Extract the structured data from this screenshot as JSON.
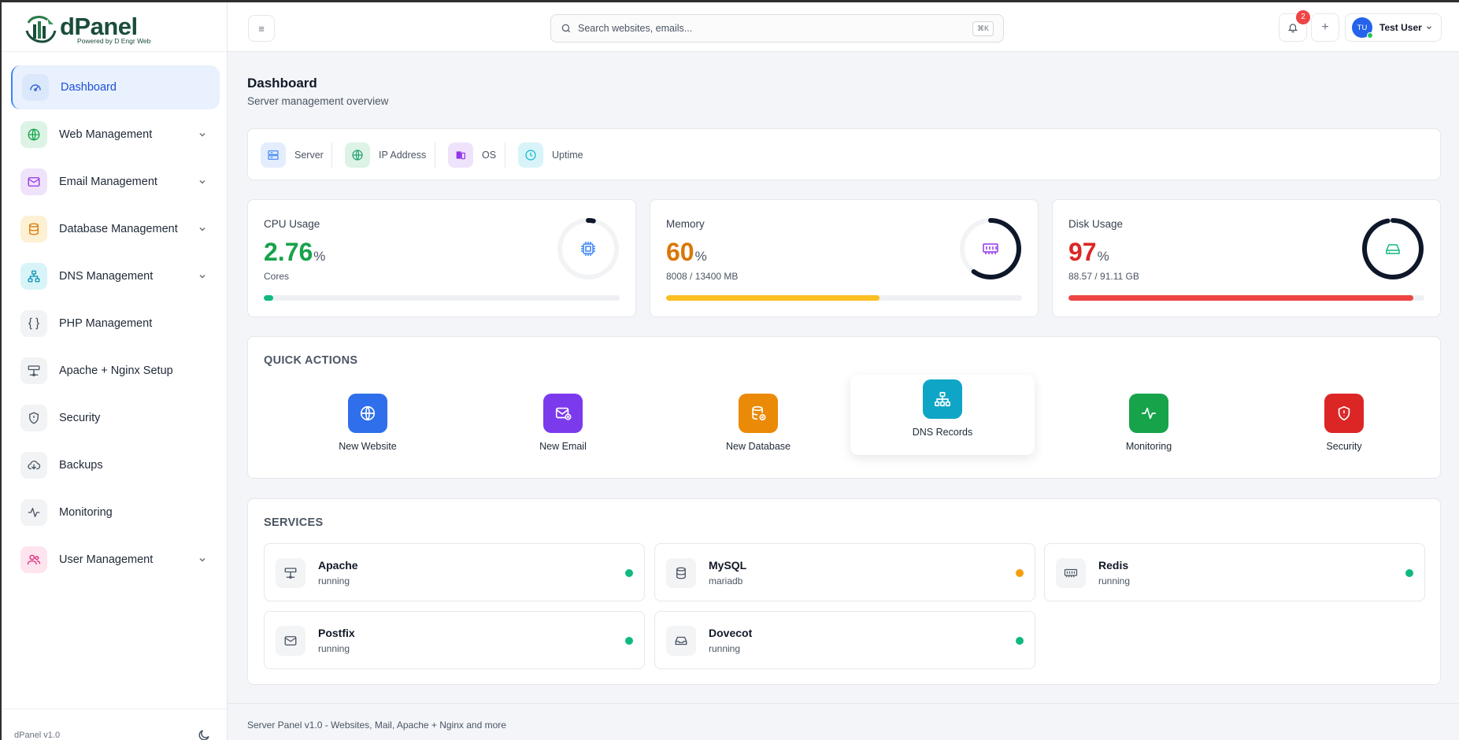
{
  "app": {
    "name": "dPanel",
    "tagline": "Powered by D Engr Web",
    "version": "dPanel v1.0"
  },
  "sidebar": {
    "items": [
      {
        "label": "Dashboard",
        "icon": "gauge-icon",
        "active": true
      },
      {
        "label": "Web Management",
        "icon": "globe-icon",
        "expandable": true
      },
      {
        "label": "Email Management",
        "icon": "mail-icon",
        "expandable": true
      },
      {
        "label": "Database Management",
        "icon": "database-icon",
        "expandable": true
      },
      {
        "label": "DNS Management",
        "icon": "network-icon",
        "expandable": true
      },
      {
        "label": "PHP Management",
        "icon": "braces-icon"
      },
      {
        "label": "Apache + Nginx Setup",
        "icon": "server-icon"
      },
      {
        "label": "Security",
        "icon": "shield-icon"
      },
      {
        "label": "Backups",
        "icon": "cloud-download-icon"
      },
      {
        "label": "Monitoring",
        "icon": "activity-icon"
      },
      {
        "label": "User Management",
        "icon": "users-icon",
        "expandable": true
      }
    ]
  },
  "header": {
    "menu_glyph": "≡",
    "search_placeholder": "Search websites, emails...",
    "search_shortcut": "⌘K",
    "notification_count": "2",
    "add_glyph": "+",
    "user": {
      "initials": "TU",
      "name": "Test User"
    }
  },
  "page": {
    "title": "Dashboard",
    "subtitle": "Server management overview"
  },
  "info_bar": [
    {
      "label": "Server",
      "icon": "server-icon",
      "color": "#3b82f6"
    },
    {
      "label": "IP Address",
      "icon": "globe-icon",
      "color": "#22a06b"
    },
    {
      "label": "OS",
      "icon": "os-icon",
      "color": "#9333ea"
    },
    {
      "label": "Uptime",
      "icon": "clock-icon",
      "color": "#06b6d4"
    }
  ],
  "stats": {
    "cpu": {
      "title": "CPU Usage",
      "value": "2.76",
      "unit": "%",
      "sub": "Cores",
      "percent": 2.76,
      "color": "#16a34a"
    },
    "memory": {
      "title": "Memory",
      "value": "60",
      "unit": "%",
      "sub": "8008 / 13400 MB",
      "percent": 60,
      "color": "#d97706"
    },
    "disk": {
      "title": "Disk Usage",
      "value": "97",
      "unit": "%",
      "sub": "88.57 / 91.11 GB",
      "percent": 97,
      "color": "#dc2626"
    }
  },
  "quick_actions": {
    "title": "QUICK ACTIONS",
    "items": [
      {
        "label": "New Website",
        "icon": "globe-icon",
        "color": "#2f6fec"
      },
      {
        "label": "New Email",
        "icon": "mail-plus-icon",
        "color": "#7c3aed"
      },
      {
        "label": "New Database",
        "icon": "database-plus-icon",
        "color": "#ea8a07"
      },
      {
        "label": "DNS Records",
        "icon": "network-icon",
        "color": "#0ea5c6"
      },
      {
        "label": "Monitoring",
        "icon": "activity-icon",
        "color": "#16a34a"
      },
      {
        "label": "Security",
        "icon": "shield-icon",
        "color": "#dc2626"
      }
    ]
  },
  "services": {
    "title": "SERVICES",
    "items": [
      {
        "name": "Apache",
        "status": "running",
        "icon": "server-icon",
        "dot": "#10b981"
      },
      {
        "name": "MySQL",
        "status": "mariadb",
        "icon": "database-icon",
        "dot": "#f59e0b"
      },
      {
        "name": "Redis",
        "status": "running",
        "icon": "memory-icon",
        "dot": "#10b981"
      },
      {
        "name": "Postfix",
        "status": "running",
        "icon": "mail-icon",
        "dot": "#10b981"
      },
      {
        "name": "Dovecot",
        "status": "running",
        "icon": "inbox-icon",
        "dot": "#10b981"
      }
    ]
  },
  "footer": {
    "text": "Server Panel v1.0 - Websites, Mail, Apache + Nginx and more"
  }
}
